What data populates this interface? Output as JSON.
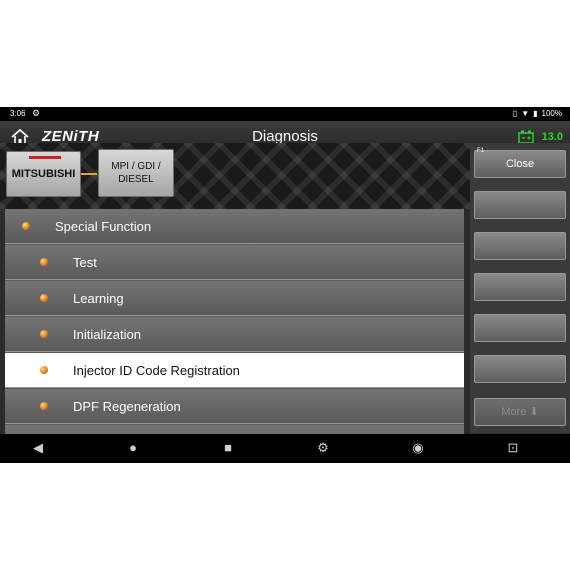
{
  "status": {
    "time": "3:06",
    "battery": "100%"
  },
  "header": {
    "logo": "ZENiTH",
    "title": "Diagnosis",
    "voltage": "13.0"
  },
  "breadcrumb": {
    "brand": "MITSUBISHI",
    "system": "MPI / GDI / DIESEL"
  },
  "menu": {
    "items": [
      {
        "label": "Special Function",
        "level": 0,
        "selected": false
      },
      {
        "label": "Test",
        "level": 1,
        "selected": false
      },
      {
        "label": "Learning",
        "level": 1,
        "selected": false
      },
      {
        "label": "Initialization",
        "level": 1,
        "selected": false
      },
      {
        "label": "Injector ID Code Registration",
        "level": 1,
        "selected": true
      },
      {
        "label": "DPF Regeneration",
        "level": 1,
        "selected": false
      }
    ]
  },
  "side_buttons": {
    "f1_key": "F1",
    "close": "Close",
    "more": "More"
  },
  "colors": {
    "accent_green": "#2fd02f",
    "selected_row": "#ffffff",
    "bullet_orange": "#e08a1a",
    "brand_red": "#d02020"
  },
  "icons": [
    "home-icon",
    "battery-icon",
    "back-icon",
    "home-circle-icon",
    "recents-icon",
    "settings-icon",
    "chrome-icon",
    "screenshot-icon"
  ]
}
